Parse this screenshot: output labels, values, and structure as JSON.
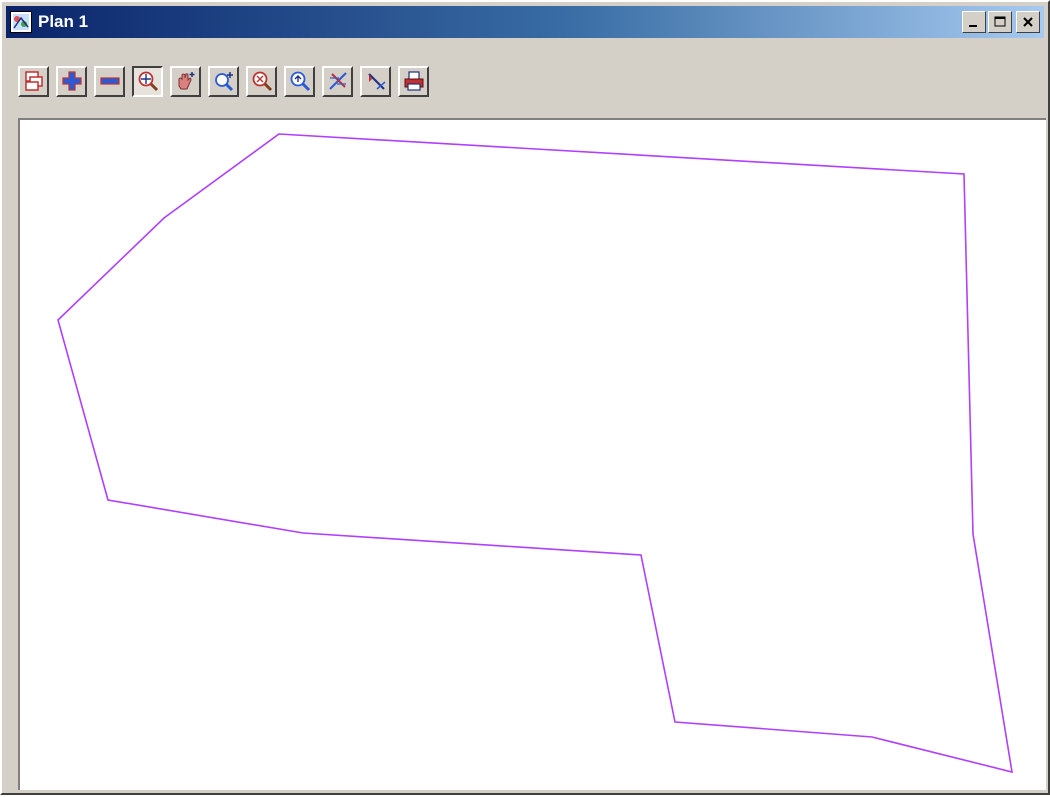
{
  "window": {
    "title": "Plan 1",
    "app_icon": "plan-view-icon"
  },
  "controls": {
    "minimize_icon": "minimize-icon",
    "maximize_icon": "maximize-icon",
    "close_icon": "close-icon"
  },
  "toolbar": {
    "buttons": [
      {
        "icon": "layers-icon"
      },
      {
        "icon": "plus-icon"
      },
      {
        "icon": "minus-icon"
      },
      {
        "icon": "zoom-extents-icon",
        "active": true
      },
      {
        "icon": "pan-hand-icon"
      },
      {
        "icon": "zoom-in-icon"
      },
      {
        "icon": "zoom-window-icon"
      },
      {
        "icon": "zoom-previous-icon"
      },
      {
        "icon": "cut-icon"
      },
      {
        "icon": "pick-icon"
      },
      {
        "icon": "print-icon"
      }
    ]
  },
  "plan": {
    "line_color": "#b040ff",
    "polygon": "boundary"
  },
  "colors": {
    "titlebar_start": "#0a246a",
    "titlebar_end": "#a6caf0",
    "face": "#d4d0c8",
    "accent_blue": "#2a5bd7",
    "accent_red": "#c03030"
  }
}
